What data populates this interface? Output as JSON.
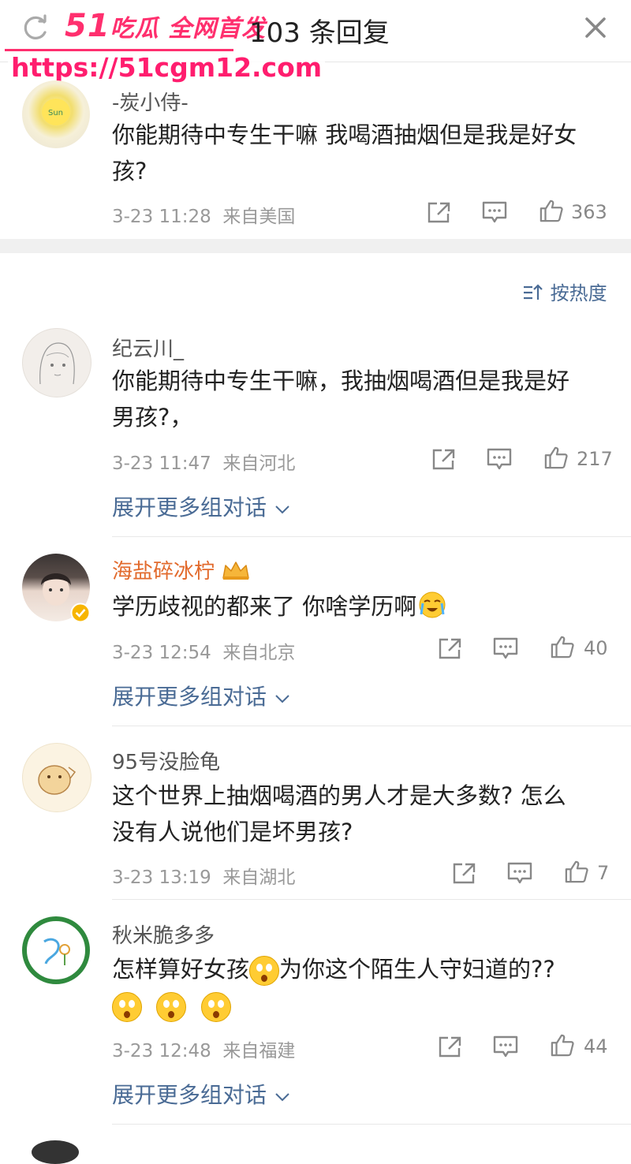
{
  "header": {
    "title": "103 条回复",
    "watermark_brand_num": "51",
    "watermark_brand": "吃瓜 全网首发",
    "watermark_url": "https://51cgm12.com"
  },
  "root_comment": {
    "user": "-炭小侍-",
    "text_line1": "你能期待中专生干嘛 我喝酒抽烟但是我是好女",
    "text_line2": "孩?",
    "time": "3-23 11:28",
    "location": "来自美国",
    "likes": "363"
  },
  "sort_label": "按热度",
  "expand_label": "展开更多组对话",
  "comments": [
    {
      "user": "纪云川_",
      "text_line1": "你能期待中专生干嘛，我抽烟喝酒但是我是好",
      "text_line2": "男孩?，",
      "time": "3-23 11:47",
      "location": "来自河北",
      "likes": "217"
    },
    {
      "user": "海盐碎冰柠",
      "text_line1": "学历歧视的都来了 你啥学历啊",
      "time": "3-23 12:54",
      "location": "来自北京",
      "likes": "40"
    },
    {
      "user": "95号没脸龟",
      "text_line1": "这个世界上抽烟喝酒的男人才是大多数? 怎么",
      "text_line2": "没有人说他们是坏男孩?",
      "time": "3-23 13:19",
      "location": "来自湖北",
      "likes": "7"
    },
    {
      "user": "秋米脆多多",
      "text_line1a": "怎样算好女孩",
      "text_line1b": "为你这个陌生人守妇道的??",
      "time": "3-23 12:48",
      "location": "来自福建",
      "likes": "44"
    }
  ],
  "colors": {
    "accent_link": "#4a6b95",
    "vip_name": "#e26a2c",
    "watermark": "#ff2f6e"
  },
  "icons": [
    "refresh-icon",
    "close-icon",
    "share-icon",
    "comment-icon",
    "like-icon",
    "sort-icon",
    "chevron-down-icon",
    "crown-icon",
    "verified-icon",
    "emoji-icon"
  ]
}
